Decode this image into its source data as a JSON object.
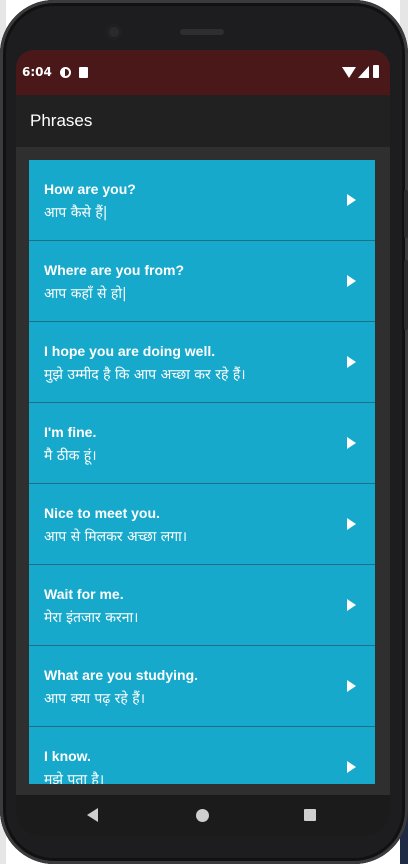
{
  "status_bar": {
    "time": "6:04",
    "icons": [
      "notification-icon",
      "sd-card-icon",
      "wifi-icon",
      "signal-icon",
      "battery-icon"
    ]
  },
  "app_bar": {
    "title": "Phrases"
  },
  "phrases": [
    {
      "english": "How are you?",
      "hindi": "आप कैसे हैं|"
    },
    {
      "english": "Where are you from?",
      "hindi": "आप कहाँ से हो|"
    },
    {
      "english": "I hope you are doing well.",
      "hindi": "मुझे उम्मीद है कि आप अच्छा कर रहे हैं।"
    },
    {
      "english": "I'm fine.",
      "hindi": "मै ठीक हूं।"
    },
    {
      "english": "Nice to meet  you.",
      "hindi": "आप से मिलकर अच्छा लगा।"
    },
    {
      "english": "Wait for me.",
      "hindi": "मेरा इंतजार करना।"
    },
    {
      "english": "What are you studying.",
      "hindi": "आप क्या पढ़ रहे हैं।"
    },
    {
      "english": "I know.",
      "hindi": "मुझे पता है।"
    }
  ],
  "colors": {
    "row_background": "#16a9cb",
    "status_bar": "#4a1818",
    "app_bar": "#212121",
    "screen_background": "#2f2f30"
  },
  "navigation_bar": {
    "icons": [
      "back-icon",
      "home-icon",
      "recents-icon"
    ]
  }
}
